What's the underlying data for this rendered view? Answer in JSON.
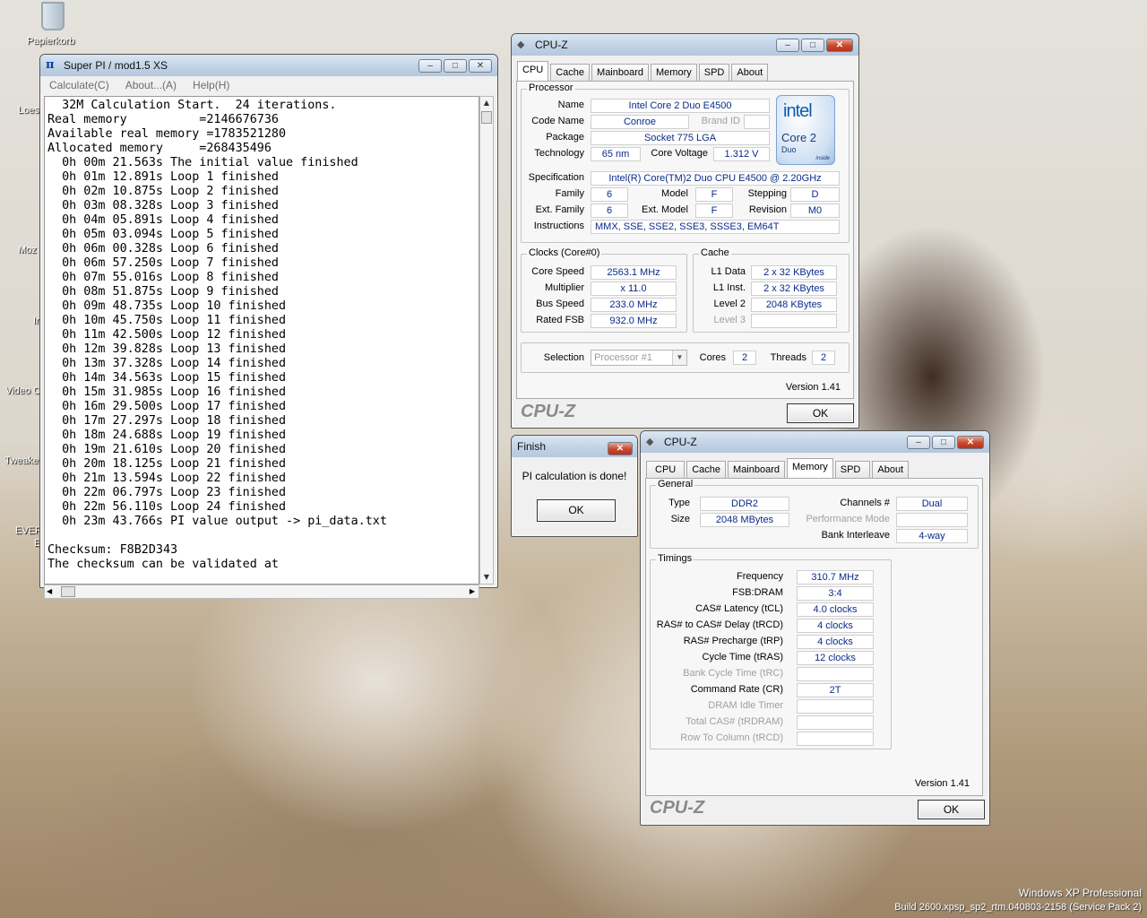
{
  "desktop": {
    "icons": [
      "Papierkorb",
      "Loes",
      "Moz",
      "Ir",
      "Video C",
      "Tweake",
      "EVER",
      "E"
    ],
    "watermark_os": "Windows XP Professional",
    "watermark_build": "Build 2600.xpsp_sp2_rtm.040803-2158 (Service Pack 2)"
  },
  "superpi": {
    "title": "Super PI / mod1.5 XS",
    "menu": [
      "Calculate(C)",
      "About...(A)",
      "Help(H)"
    ],
    "console_lines": [
      "  32M Calculation Start.  24 iterations.",
      "Real memory          =2146676736",
      "Available real memory =1783521280",
      "Allocated memory     =268435496",
      "  0h 00m 21.563s The initial value finished",
      "  0h 01m 12.891s Loop 1 finished",
      "  0h 02m 10.875s Loop 2 finished",
      "  0h 03m 08.328s Loop 3 finished",
      "  0h 04m 05.891s Loop 4 finished",
      "  0h 05m 03.094s Loop 5 finished",
      "  0h 06m 00.328s Loop 6 finished",
      "  0h 06m 57.250s Loop 7 finished",
      "  0h 07m 55.016s Loop 8 finished",
      "  0h 08m 51.875s Loop 9 finished",
      "  0h 09m 48.735s Loop 10 finished",
      "  0h 10m 45.750s Loop 11 finished",
      "  0h 11m 42.500s Loop 12 finished",
      "  0h 12m 39.828s Loop 13 finished",
      "  0h 13m 37.328s Loop 14 finished",
      "  0h 14m 34.563s Loop 15 finished",
      "  0h 15m 31.985s Loop 16 finished",
      "  0h 16m 29.500s Loop 17 finished",
      "  0h 17m 27.297s Loop 18 finished",
      "  0h 18m 24.688s Loop 19 finished",
      "  0h 19m 21.610s Loop 20 finished",
      "  0h 20m 18.125s Loop 21 finished",
      "  0h 21m 13.594s Loop 22 finished",
      "  0h 22m 06.797s Loop 23 finished",
      "  0h 22m 56.110s Loop 24 finished",
      "  0h 23m 43.766s PI value output -> pi_data.txt",
      "",
      "Checksum: F8B2D343",
      "The checksum can be validated at"
    ]
  },
  "finish_dialog": {
    "title": "Finish",
    "message": "PI calculation is done!",
    "ok": "OK"
  },
  "cpuz_cpu": {
    "title": "CPU-Z",
    "tabs": [
      "CPU",
      "Cache",
      "Mainboard",
      "Memory",
      "SPD",
      "About"
    ],
    "processor_group": "Processor",
    "labels": {
      "name": "Name",
      "codename": "Code Name",
      "brandid": "Brand ID",
      "package": "Package",
      "technology": "Technology",
      "corevoltage": "Core Voltage",
      "specification": "Specification",
      "family": "Family",
      "model": "Model",
      "stepping": "Stepping",
      "extfamily": "Ext. Family",
      "extmodel": "Ext. Model",
      "revision": "Revision",
      "instructions": "Instructions"
    },
    "values": {
      "name": "Intel Core 2 Duo E4500",
      "codename": "Conroe",
      "brandid": "",
      "package": "Socket 775 LGA",
      "technology": "65 nm",
      "corevoltage": "1.312 V",
      "specification": "Intel(R) Core(TM)2 Duo CPU     E4500  @ 2.20GHz",
      "family": "6",
      "model": "F",
      "stepping": "D",
      "extfamily": "6",
      "extmodel": "F",
      "revision": "M0",
      "instructions": "MMX, SSE, SSE2, SSE3, SSSE3, EM64T"
    },
    "logo": {
      "brand": "intel",
      "line1": "Core 2",
      "line2": "Duo",
      "inside": "inside"
    },
    "clocks_group": "Clocks (Core#0)",
    "clocks": {
      "core_speed_label": "Core Speed",
      "core_speed": "2563.1 MHz",
      "multiplier_label": "Multiplier",
      "multiplier": "x 11.0",
      "bus_speed_label": "Bus Speed",
      "bus_speed": "233.0 MHz",
      "rated_fsb_label": "Rated FSB",
      "rated_fsb": "932.0 MHz"
    },
    "cache_group": "Cache",
    "cache": {
      "l1data_label": "L1 Data",
      "l1data": "2 x 32 KBytes",
      "l1inst_label": "L1 Inst.",
      "l1inst": "2 x 32 KBytes",
      "level2_label": "Level 2",
      "level2": "2048 KBytes",
      "level3_label": "Level 3",
      "level3": ""
    },
    "selection": {
      "label": "Selection",
      "value": "Processor #1",
      "cores_label": "Cores",
      "cores": "2",
      "threads_label": "Threads",
      "threads": "2"
    },
    "version": "Version 1.41",
    "brand": "CPU-Z",
    "ok": "OK"
  },
  "cpuz_mem": {
    "title": "CPU-Z",
    "tabs": [
      "CPU",
      "Cache",
      "Mainboard",
      "Memory",
      "SPD",
      "About"
    ],
    "general_group": "General",
    "general": {
      "type_label": "Type",
      "type": "DDR2",
      "size_label": "Size",
      "size": "2048 MBytes",
      "channels_label": "Channels #",
      "channels": "Dual",
      "perf_label": "Performance Mode",
      "perf": "",
      "interleave_label": "Bank Interleave",
      "interleave": "4-way"
    },
    "timings_group": "Timings",
    "timings": [
      {
        "label": "Frequency",
        "value": "310.7 MHz",
        "dim": false
      },
      {
        "label": "FSB:DRAM",
        "value": "3:4",
        "dim": false
      },
      {
        "label": "CAS# Latency (tCL)",
        "value": "4.0 clocks",
        "dim": false
      },
      {
        "label": "RAS# to CAS# Delay (tRCD)",
        "value": "4 clocks",
        "dim": false
      },
      {
        "label": "RAS# Precharge (tRP)",
        "value": "4 clocks",
        "dim": false
      },
      {
        "label": "Cycle Time (tRAS)",
        "value": "12 clocks",
        "dim": false
      },
      {
        "label": "Bank Cycle Time (tRC)",
        "value": "",
        "dim": true
      },
      {
        "label": "Command Rate (CR)",
        "value": "2T",
        "dim": false
      },
      {
        "label": "DRAM Idle Timer",
        "value": "",
        "dim": true
      },
      {
        "label": "Total CAS# (tRDRAM)",
        "value": "",
        "dim": true
      },
      {
        "label": "Row To Column (tRCD)",
        "value": "",
        "dim": true
      }
    ],
    "version": "Version 1.41",
    "brand": "CPU-Z",
    "ok": "OK"
  }
}
